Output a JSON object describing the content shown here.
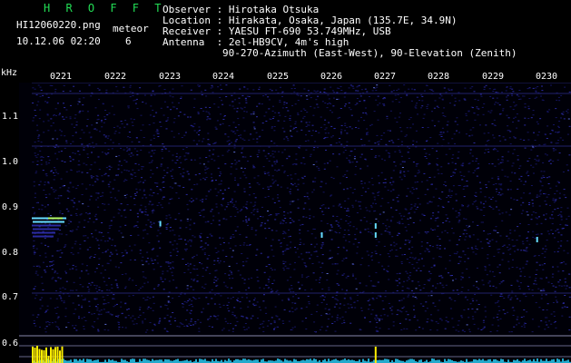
{
  "app": {
    "name": "H R O F F T",
    "filename": "HI12060220.png",
    "datetime": "10.12.06 02:20",
    "meteor_label": "meteor",
    "meteor_count": "6"
  },
  "info": {
    "observer": {
      "label": "Observer : ",
      "value": "Hirotaka Otsuka"
    },
    "location": {
      "label": "Location : ",
      "value": "Hirakata, Osaka, Japan (135.7E, 34.9N)"
    },
    "receiver": {
      "label": "Receiver : ",
      "value": "YAESU FT-690 53.749MHz, USB"
    },
    "antenna": {
      "label": "Antenna  : ",
      "value": "2el-HB9CV, 4m's high"
    },
    "antenna2": "90-270-Azimuth (East-West), 90-Elevation (Zenith)"
  },
  "axes": {
    "y_unit": "kHz",
    "y_ticks": [
      "1.1",
      "1.0",
      "0.9",
      "0.8",
      "0.7",
      "0.6"
    ],
    "x_ticks": [
      "0221",
      "0222",
      "0223",
      "0224",
      "0225",
      "0226",
      "0227",
      "0228",
      "0229",
      "0230"
    ]
  },
  "colors": {
    "background": "#000000",
    "noise": "#2a2aa0",
    "signal": "#66ddff",
    "meteor_strong": "#ffee00",
    "title": "#22dd55"
  },
  "events": [
    {
      "time": "0221",
      "freq_khz": 0.855,
      "type": "meteor-trail"
    },
    {
      "time": "0223",
      "freq_khz": 0.865,
      "type": "meteor"
    },
    {
      "time": "0226",
      "freq_khz": 0.84,
      "type": "meteor"
    },
    {
      "time": "0227",
      "freq_khz": 0.84,
      "type": "meteor"
    },
    {
      "time": "0227",
      "freq_khz": 0.86,
      "type": "meteor"
    },
    {
      "time": "0230",
      "freq_khz": 0.83,
      "type": "meteor"
    }
  ]
}
